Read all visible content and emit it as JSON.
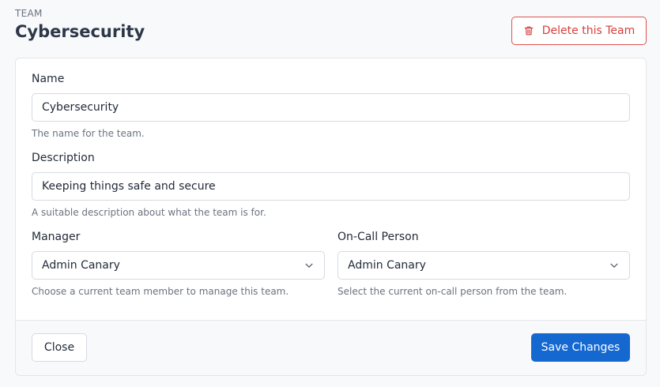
{
  "header": {
    "eyebrow": "TEAM",
    "title": "Cybersecurity",
    "delete_label": "Delete this Team",
    "delete_icon": "trash-icon",
    "danger_color": "#d43f3a"
  },
  "form": {
    "name": {
      "label": "Name",
      "value": "Cybersecurity",
      "help": "The name for the team."
    },
    "description": {
      "label": "Description",
      "value": "Keeping things safe and secure",
      "help": "A suitable description about what the team is for."
    },
    "manager": {
      "label": "Manager",
      "selected": "Admin Canary",
      "help": "Choose a current team member to manage this team."
    },
    "oncall": {
      "label": "On-Call Person",
      "selected": "Admin Canary",
      "help": "Select the current on-call person from the team."
    }
  },
  "footer": {
    "close_label": "Close",
    "save_label": "Save Changes",
    "primary_color": "#1468d0"
  }
}
